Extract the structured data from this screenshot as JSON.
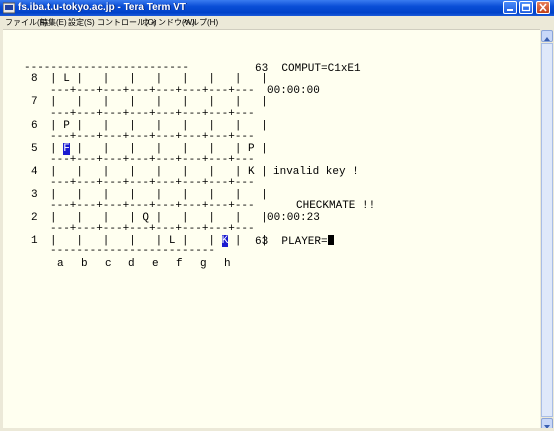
{
  "window": {
    "title": "fs.iba.t.u-tokyo.ac.jp - Tera Term VT",
    "controls": [
      "minimize",
      "maximize",
      "close"
    ]
  },
  "menu": [
    "ファイル(F)",
    "編集(E)",
    "設定(S)",
    "コントロール(O)",
    "ウィンドウ(W)",
    "ヘルプ(H)"
  ],
  "board": {
    "border_top": "-------------------------",
    "separator": "---+---+---+---+---+---+---+---",
    "border_bottom": "-------------------------",
    "ranks": [
      {
        "label": "8",
        "row": "| L |   |   |   |   |   |   |   |"
      },
      {
        "label": "7",
        "row": "|   |   |   |   |   |   |   |   |"
      },
      {
        "label": "6",
        "row": "| P |   |   |   |   |   |   |   |"
      },
      {
        "label": "5",
        "row_pre": "| ",
        "selected": "F",
        "row_post": " |   |   |   |   |   |   | P |"
      },
      {
        "label": "4",
        "row": "|   |   |   |   |   |   |   | K |"
      },
      {
        "label": "3",
        "row": "|   |   |   |   |   |   |   |   |"
      },
      {
        "label": "2",
        "row": "|   |   |   | Q |   |   |   |   |"
      },
      {
        "label": "1",
        "row_pre": "|   |   |   |   | L |   | ",
        "selected": "K",
        "row_post": " |   |"
      }
    ],
    "files": [
      "a",
      "b",
      "c",
      "d",
      "e",
      "f",
      "g",
      "h"
    ]
  },
  "status": {
    "computer_move": "63  COMPUT=C1xE1",
    "computer_time": "00:00:00",
    "message": "invalid key !",
    "checkmate": "CHECKMATE !!",
    "player_time": "00:00:23",
    "player_prompt": "63  PLAYER="
  }
}
